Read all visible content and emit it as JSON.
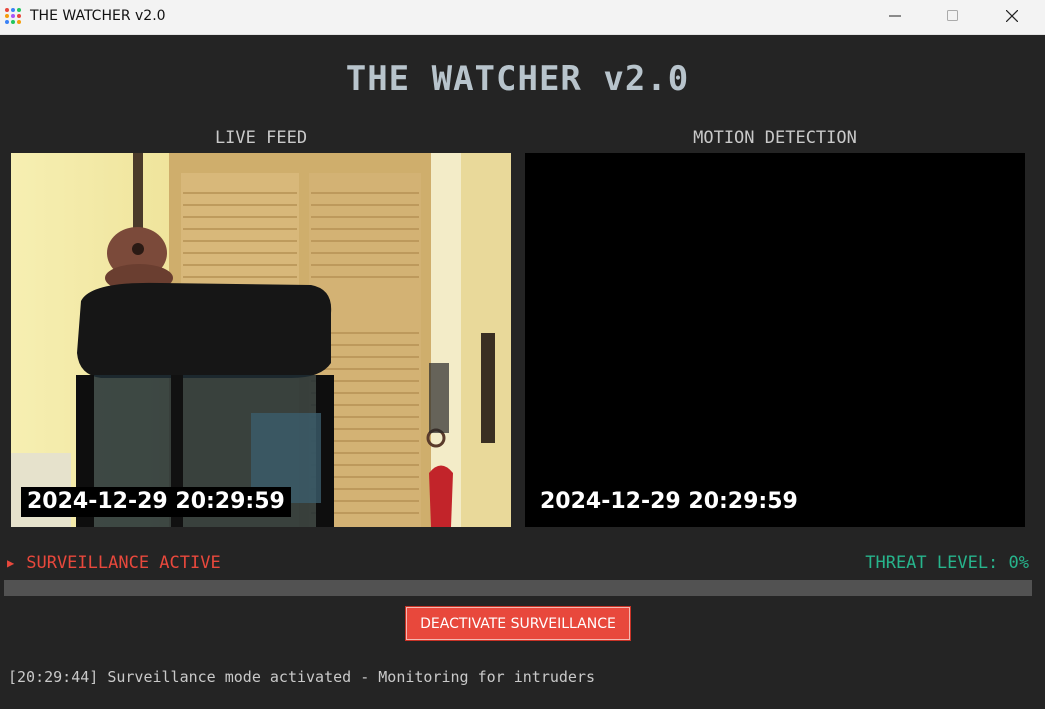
{
  "window": {
    "title": "THE WATCHER v2.0",
    "minimize_icon": "minimize-icon",
    "maximize_icon": "maximize-icon",
    "close_icon": "close-icon"
  },
  "app": {
    "title": "THE WATCHER v2.0"
  },
  "feeds": {
    "live": {
      "label": "LIVE FEED",
      "timestamp": "2024-12-29 20:29:59"
    },
    "motion": {
      "label": "MOTION DETECTION",
      "timestamp": "2024-12-29 20:29:59"
    }
  },
  "status": {
    "indicator_icon": "play-triangle-icon",
    "state": "SURVEILLANCE ACTIVE",
    "threat_level": "THREAT LEVEL: 0%",
    "threat_value": 0
  },
  "controls": {
    "deactivate_label": "DEACTIVATE SURVEILLANCE"
  },
  "log": {
    "entries": [
      "[20:29:44] Surveillance mode activated - Monitoring for intruders"
    ]
  },
  "colors": {
    "background": "#242424",
    "title": "#b8c4cc",
    "active": "#e8483c",
    "threat": "#27b48c",
    "progress_track": "#525252"
  }
}
